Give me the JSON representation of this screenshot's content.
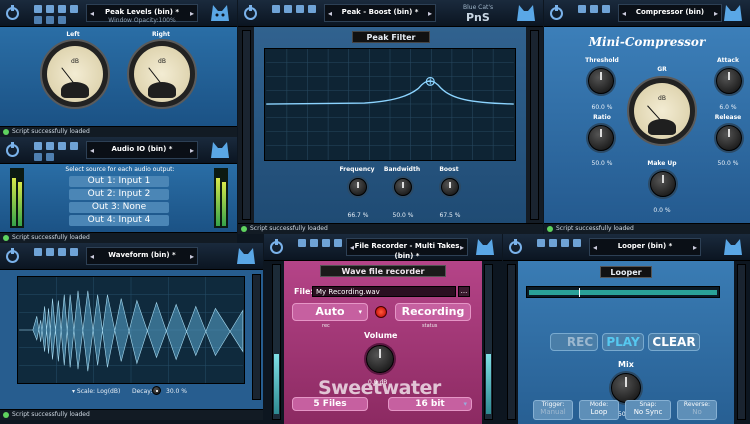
{
  "colors": {
    "panel_blue": "#2a6ea6",
    "accent_cyan": "#56c8f0",
    "recorder_magenta": "#a33573",
    "status_green": "#5fd35f"
  },
  "peak_levels": {
    "preset": "Peak Levels (bin) *",
    "preset_sub": "Window Opacity:100%",
    "left_label": "Left",
    "right_label": "Right",
    "meter_unit": "dB",
    "status": "Script successfully loaded"
  },
  "audio_io": {
    "preset": "Audio IO (bin) *",
    "instruction": "Select source for each audio output:",
    "outputs": [
      "Out 1: Input 1",
      "Out 2: Input 2",
      "Out 3: None",
      "Out 4: Input 4"
    ],
    "status": "Script successfully loaded"
  },
  "peak_filter": {
    "preset": "Peak - Boost (bin) *",
    "brand_line1": "Blue Cat's",
    "brand_line2": "PnS",
    "title": "Peak Filter",
    "knobs": [
      {
        "label": "Frequency",
        "value": "66.7 %"
      },
      {
        "label": "Bandwidth",
        "value": "50.0 %"
      },
      {
        "label": "Boost",
        "value": "67.5 %"
      }
    ],
    "status": "Script successfully loaded"
  },
  "compressor": {
    "preset": "Compressor (bin)",
    "title": "Mini-Compressor",
    "gr_label": "GR",
    "meter_unit": "dB",
    "knobs": [
      {
        "label": "Threshold",
        "value": "60.0 %"
      },
      {
        "label": "Ratio",
        "value": "50.0 %"
      },
      {
        "label": "Attack",
        "value": "6.0 %"
      },
      {
        "label": "Release",
        "value": "50.0 %"
      },
      {
        "label": "Make Up",
        "value": "0.0 %"
      }
    ],
    "status": "Script successfully loaded"
  },
  "waveform": {
    "preset": "Waveform (bin) *",
    "scale_label": "▾ Scale: Log(dB)",
    "decay_label": "Decay:",
    "decay_value": "30.0 %",
    "status": "Script successfully loaded"
  },
  "recorder": {
    "preset": "File Recorder - Multi Takes (bin) *",
    "title": "Wave file recorder",
    "file_label": "File:",
    "file_value": "My Recording.wav",
    "browse": "...",
    "auto_label": "Auto",
    "rec_label": "rec",
    "recording_label": "Recording",
    "status_label": "status",
    "volume_label": "Volume",
    "volume_value": "0.0 dB",
    "files_label": "5 Files",
    "bits_label": "16 bit",
    "watermark": "Sweetwater"
  },
  "looper": {
    "preset": "Looper (bin) *",
    "title": "Looper",
    "rec": "REC",
    "play": "PLAY",
    "clear": "CLEAR",
    "mix_label": "Mix",
    "mix_value": "50 %",
    "options": [
      {
        "label": "Trigger:",
        "value": "Manual"
      },
      {
        "label": "Mode:",
        "value": "Loop"
      },
      {
        "label": "Snap:",
        "value": "No Sync"
      },
      {
        "label": "Reverse:",
        "value": "No"
      }
    ]
  }
}
